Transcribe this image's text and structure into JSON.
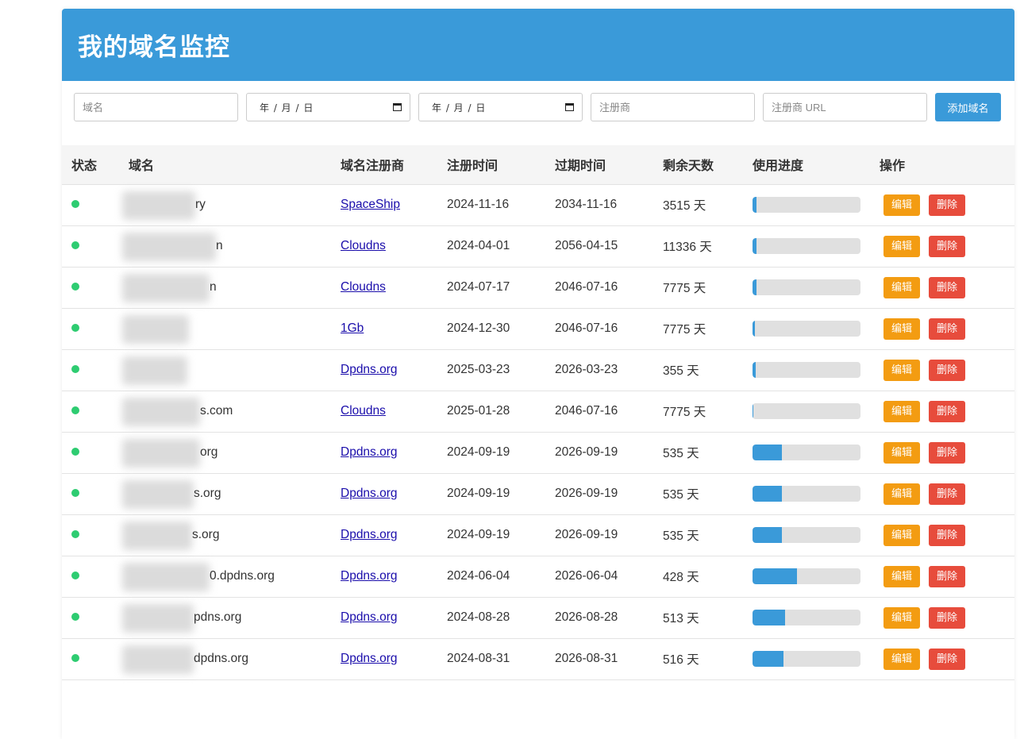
{
  "header": {
    "title": "我的域名监控"
  },
  "toolbar": {
    "domain_placeholder": "域名",
    "reg_date_text": "年 / 月 / 日",
    "exp_date_text": "年 / 月 / 日",
    "registrar_placeholder": "注册商",
    "registrar_url_placeholder": "注册商 URL",
    "add_button": "添加域名"
  },
  "table": {
    "headers": {
      "status": "状态",
      "domain": "域名",
      "registrar": "域名注册商",
      "reg_date": "注册时间",
      "exp_date": "过期时间",
      "days_left": "剩余天数",
      "progress": "使用进度",
      "actions": "操作"
    },
    "edit_label": "编辑",
    "delete_label": "删除",
    "rows": [
      {
        "domain": "ry",
        "registrar": "SpaceShip",
        "reg_date": "2024-11-16",
        "exp_date": "2034-11-16",
        "days_left": "3515 天",
        "progress": 0.04,
        "status_color": "#2ecc71"
      },
      {
        "domain": "n",
        "registrar": "Cloudns",
        "reg_date": "2024-04-01",
        "exp_date": "2056-04-15",
        "days_left": "11336 天",
        "progress": 0.035,
        "status_color": "#2ecc71"
      },
      {
        "domain": "n",
        "registrar": "Cloudns",
        "reg_date": "2024-07-17",
        "exp_date": "2046-07-16",
        "days_left": "7775 天",
        "progress": 0.035,
        "status_color": "#2ecc71"
      },
      {
        "domain": "",
        "registrar": "1Gb",
        "reg_date": "2024-12-30",
        "exp_date": "2046-07-16",
        "days_left": "7775 天",
        "progress": 0.02,
        "status_color": "#2ecc71"
      },
      {
        "domain": "",
        "registrar": "Dpdns.org",
        "reg_date": "2025-03-23",
        "exp_date": "2026-03-23",
        "days_left": "355 天",
        "progress": 0.03,
        "status_color": "#2ecc71"
      },
      {
        "domain": "s.com",
        "registrar": "Cloudns",
        "reg_date": "2025-01-28",
        "exp_date": "2046-07-16",
        "days_left": "7775 天",
        "progress": 0.01,
        "status_color": "#2ecc71"
      },
      {
        "domain": "org",
        "registrar": "Dpdns.org",
        "reg_date": "2024-09-19",
        "exp_date": "2026-09-19",
        "days_left": "535 天",
        "progress": 0.27,
        "status_color": "#2ecc71"
      },
      {
        "domain": "s.org",
        "registrar": "Dpdns.org",
        "reg_date": "2024-09-19",
        "exp_date": "2026-09-19",
        "days_left": "535 天",
        "progress": 0.27,
        "status_color": "#2ecc71"
      },
      {
        "domain": "s.org",
        "registrar": "Dpdns.org",
        "reg_date": "2024-09-19",
        "exp_date": "2026-09-19",
        "days_left": "535 天",
        "progress": 0.27,
        "status_color": "#2ecc71"
      },
      {
        "domain": "0.dpdns.org",
        "registrar": "Dpdns.org",
        "reg_date": "2024-06-04",
        "exp_date": "2026-06-04",
        "days_left": "428 天",
        "progress": 0.41,
        "status_color": "#2ecc71"
      },
      {
        "domain": "pdns.org",
        "registrar": "Dpdns.org",
        "reg_date": "2024-08-28",
        "exp_date": "2026-08-28",
        "days_left": "513 天",
        "progress": 0.3,
        "status_color": "#2ecc71"
      },
      {
        "domain": "dpdns.org",
        "registrar": "Dpdns.org",
        "reg_date": "2024-08-31",
        "exp_date": "2026-08-31",
        "days_left": "516 天",
        "progress": 0.29,
        "status_color": "#2ecc71"
      }
    ]
  },
  "colors": {
    "primary": "#3a9ad9",
    "status_ok": "#2ecc71",
    "edit": "#f39c12",
    "delete": "#e74c3c",
    "link": "#1a0dab"
  }
}
